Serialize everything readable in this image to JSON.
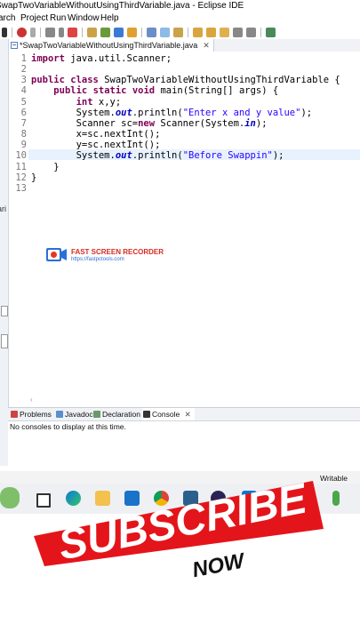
{
  "window": {
    "title": "SwapTwoVariableWithoutUsingThirdVariable.java - Eclipse IDE"
  },
  "menu": {
    "items": [
      "Search",
      "Project",
      "Run",
      "Window",
      "Help"
    ],
    "visible_labels": [
      "arch",
      "Project",
      "Run",
      "Window",
      "Help"
    ]
  },
  "editor": {
    "tab_label": "*SwapTwoVariableWithoutUsingThirdVariable.java",
    "line_numbers": [
      "1",
      "2",
      "3",
      "4",
      "5",
      "6",
      "7",
      "8",
      "9",
      "10",
      "11",
      "12",
      "13"
    ],
    "current_line": 10,
    "lines": [
      "import java.util.Scanner;",
      "",
      "public class SwapTwoVariableWithoutUsingThirdVariable {",
      "    public static void main(String[] args) {",
      "        int x,y;",
      "        System.out.println(\"Enter x and y value\");",
      "        Scanner sc=new Scanner(System.in);",
      "        x=sc.nextInt();",
      "        y=sc.nextInt();",
      "        System.out.println(\"Before Swappin\");",
      "    }",
      "}",
      ""
    ]
  },
  "left_strip": {
    "label": "ari"
  },
  "watermark": {
    "title": "FAST SCREEN RECORDER",
    "url": "https://fastpctools.com"
  },
  "views": {
    "tabs": [
      {
        "label": "Problems",
        "icon": "problems-icon",
        "active": false
      },
      {
        "label": "Javadoc",
        "icon": "javadoc-icon",
        "active": false
      },
      {
        "label": "Declaration",
        "icon": "declaration-icon",
        "active": false
      },
      {
        "label": "Console",
        "icon": "console-icon",
        "active": true
      }
    ],
    "console_message": "No consoles to display at this time."
  },
  "statusbar": {
    "mode": "Writable"
  },
  "taskbar": {
    "icons": [
      "plant-icon",
      "task-view-icon",
      "edge-icon",
      "file-explorer-icon",
      "mail-icon",
      "chrome-icon",
      "database-icon",
      "eclipse-icon",
      "vscode-icon",
      "mongodb-icon"
    ]
  },
  "overlay": {
    "line1": "SUBSCRIBE",
    "line2": "NOW",
    "color": "#e3151a"
  }
}
